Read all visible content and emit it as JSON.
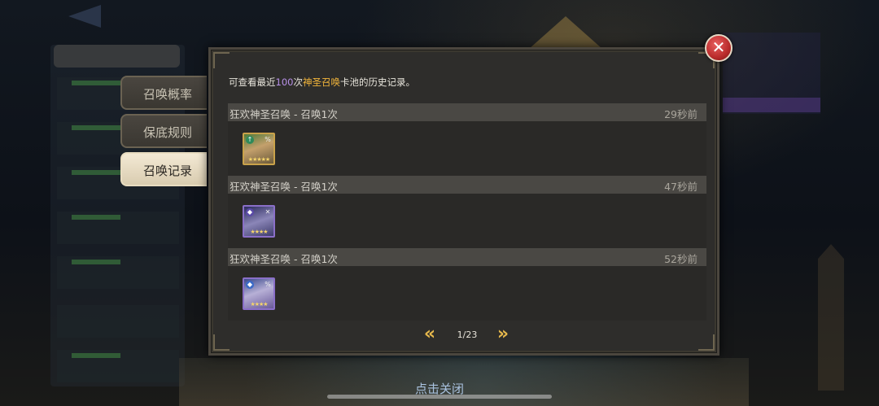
{
  "tabs": [
    {
      "label": "召唤概率",
      "active": false
    },
    {
      "label": "保底规则",
      "active": false
    },
    {
      "label": "召唤记录",
      "active": true
    }
  ],
  "info": {
    "prefix": "可查看最近",
    "count": "100",
    "middle": "次",
    "pool": "神圣召唤",
    "suffix": "卡池的历史记录。"
  },
  "records": [
    {
      "title": "狂欢神圣召唤 - 召唤1次",
      "time": "29秒前",
      "hero": {
        "icon": "hero-portrait-icon",
        "frame": "gold",
        "stars": 5
      }
    },
    {
      "title": "狂欢神圣召唤 - 召唤1次",
      "time": "47秒前",
      "hero": {
        "icon": "hero-portrait-icon",
        "frame": "purple",
        "stars": 4
      }
    },
    {
      "title": "狂欢神圣召唤 - 召唤1次",
      "time": "52秒前",
      "hero": {
        "icon": "hero-portrait-icon",
        "frame": "purple",
        "stars": 4
      }
    }
  ],
  "pagination": {
    "current": "1/23",
    "prev_icon": "double-chevron-left-icon",
    "next_icon": "double-chevron-right-icon"
  },
  "close_icon": "close-icon",
  "tap_to_close": "点击关闭",
  "colors": {
    "highlight_count": "#b891e8",
    "highlight_pool": "#f2b53b",
    "close_red": "#c43131",
    "accent_gold": "#e6b84c"
  }
}
